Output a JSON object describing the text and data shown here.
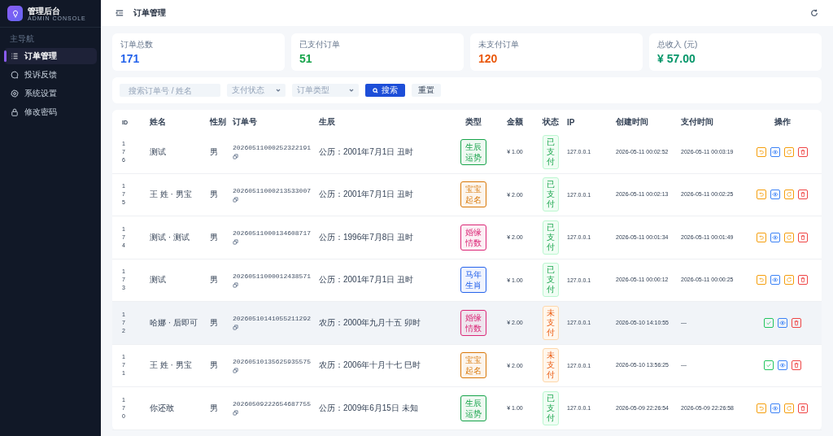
{
  "sidebar": {
    "title": "管理后台",
    "subtitle": "ADMIN CONSOLE",
    "section": "主导航",
    "items": [
      {
        "label": "订单管理",
        "kind": "list",
        "selected": true
      },
      {
        "label": "投诉反馈",
        "kind": "chat",
        "selected": false
      },
      {
        "label": "系统设置",
        "kind": "gear",
        "selected": false
      },
      {
        "label": "修改密码",
        "kind": "lock",
        "selected": false
      }
    ]
  },
  "header": {
    "title": "订单管理"
  },
  "stats": [
    {
      "label": "订单总数",
      "value": "171",
      "color": "#2563eb"
    },
    {
      "label": "已支付订单",
      "value": "51",
      "color": "#16a34a"
    },
    {
      "label": "未支付订单",
      "value": "120",
      "color": "#ea580c"
    },
    {
      "label": "总收入 (元)",
      "value": "¥ 57.00",
      "color": "#059669"
    }
  ],
  "filters": {
    "search": {
      "placeholder": "搜索订单号 / 姓名"
    },
    "selects": [
      {
        "placeholder": "支付状态"
      },
      {
        "placeholder": "订单类型"
      }
    ],
    "search_button": "搜索",
    "reset_button": "重置"
  },
  "table": {
    "columns": [
      "ID",
      "姓名",
      "性别",
      "订单号",
      "生辰",
      "类型",
      "金额",
      "状态",
      "IP",
      "创建时间",
      "支付时间",
      "操作"
    ],
    "rows": [
      {
        "id": "176",
        "name": "测试",
        "gender": "男",
        "order_no": "20260511000252322191",
        "birth": "公历：2001年7月1日 丑时",
        "type": {
          "label": "生辰运势",
          "color": "#16a34a"
        },
        "amount": "¥ 1.00",
        "status": "已支付",
        "paid": true,
        "ip": "127.0.0.1",
        "created": "2026-05-11 00:02:52",
        "paid_at": "2026-05-11 00:03:19",
        "highlighted": false,
        "actions": [
          {
            "kind": "undo"
          },
          {
            "kind": "view"
          },
          {
            "kind": "refresh"
          },
          {
            "kind": "delete"
          }
        ]
      },
      {
        "id": "175",
        "name": "王 姓 · 男宝",
        "gender": "男",
        "order_no": "20260511000213533007",
        "birth": "公历：2001年7月1日 丑时",
        "type": {
          "label": "宝宝起名",
          "color": "#d97706"
        },
        "amount": "¥ 2.00",
        "status": "已支付",
        "paid": true,
        "ip": "127.0.0.1",
        "created": "2026-05-11 00:02:13",
        "paid_at": "2026-05-11 00:02:25",
        "highlighted": false,
        "actions": [
          {
            "kind": "undo"
          },
          {
            "kind": "view"
          },
          {
            "kind": "refresh"
          },
          {
            "kind": "delete"
          }
        ]
      },
      {
        "id": "174",
        "name": "测试 · 测试",
        "gender": "男",
        "order_no": "20260511000134608717",
        "birth": "公历：1996年7月8日 丑时",
        "type": {
          "label": "婚缘情数",
          "color": "#db2777"
        },
        "amount": "¥ 2.00",
        "status": "已支付",
        "paid": true,
        "ip": "127.0.0.1",
        "created": "2026-05-11 00:01:34",
        "paid_at": "2026-05-11 00:01:49",
        "highlighted": false,
        "actions": [
          {
            "kind": "undo"
          },
          {
            "kind": "view"
          },
          {
            "kind": "refresh"
          },
          {
            "kind": "delete"
          }
        ]
      },
      {
        "id": "173",
        "name": "测试",
        "gender": "男",
        "order_no": "20260511000012438571",
        "birth": "公历：2001年7月1日 丑时",
        "type": {
          "label": "马年生肖",
          "color": "#2563eb"
        },
        "amount": "¥ 1.00",
        "status": "已支付",
        "paid": true,
        "ip": "127.0.0.1",
        "created": "2026-05-11 00:00:12",
        "paid_at": "2026-05-11 00:00:25",
        "highlighted": false,
        "actions": [
          {
            "kind": "undo"
          },
          {
            "kind": "view"
          },
          {
            "kind": "refresh"
          },
          {
            "kind": "delete"
          }
        ]
      },
      {
        "id": "172",
        "name": "哈娜 · 后即可",
        "gender": "男",
        "order_no": "20260510141055211292",
        "birth": "农历：2000年九月十五 卯时",
        "type": {
          "label": "婚缘情数",
          "color": "#db2777"
        },
        "amount": "¥ 2.00",
        "status": "未支付",
        "paid": false,
        "ip": "127.0.0.1",
        "created": "2026-05-10 14:10:55",
        "paid_at": "—",
        "highlighted": true,
        "actions": [
          {
            "kind": "confirm"
          },
          {
            "kind": "view"
          },
          {
            "kind": "delete"
          }
        ]
      },
      {
        "id": "171",
        "name": "王 姓 · 男宝",
        "gender": "男",
        "order_no": "20260510135625935575",
        "birth": "农历：2006年十月十七 巳时",
        "type": {
          "label": "宝宝起名",
          "color": "#d97706"
        },
        "amount": "¥ 2.00",
        "status": "未支付",
        "paid": false,
        "ip": "127.0.0.1",
        "created": "2026-05-10 13:56:25",
        "paid_at": "—",
        "highlighted": false,
        "actions": [
          {
            "kind": "confirm"
          },
          {
            "kind": "view"
          },
          {
            "kind": "delete"
          }
        ]
      },
      {
        "id": "170",
        "name": "你还敢",
        "gender": "男",
        "order_no": "20260509222654687755",
        "birth": "公历：2009年6月15日 未知",
        "type": {
          "label": "生辰运势",
          "color": "#16a34a"
        },
        "amount": "¥ 1.00",
        "status": "已支付",
        "paid": true,
        "ip": "127.0.0.1",
        "created": "2026-05-09 22:26:54",
        "paid_at": "2026-05-09 22:26:58",
        "highlighted": false,
        "actions": [
          {
            "kind": "undo"
          },
          {
            "kind": "view"
          },
          {
            "kind": "refresh"
          },
          {
            "kind": "delete"
          }
        ]
      }
    ]
  }
}
